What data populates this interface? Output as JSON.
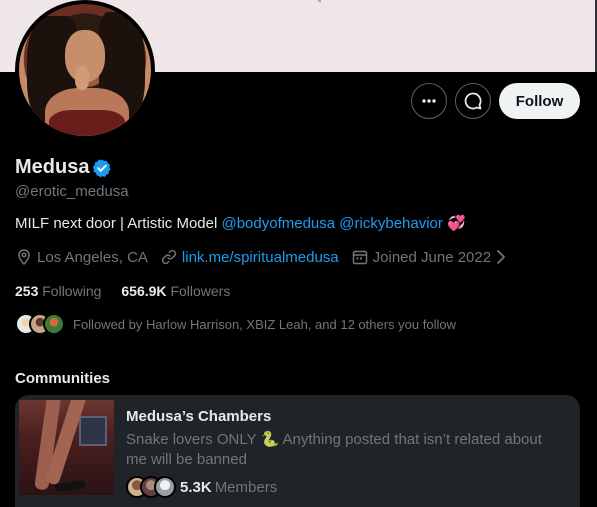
{
  "profile": {
    "name": "Medusa",
    "handle": "@erotic_medusa",
    "bio_text": "MILF next door | Artistic Model ",
    "bio_mention_1": "@bodyofmedusa",
    "bio_mention_2": "@rickybehavior",
    "bio_emoji": "💞",
    "location": "Los Angeles, CA",
    "link": "link.me/spiritualmedusa",
    "joined": "Joined June 2022",
    "following_count": "253",
    "following_label": "Following",
    "followers_count": "656.9K",
    "followers_label": "Followers",
    "followed_by": "Followed by Harlow Harrison, XBIZ Leah, and 12 others you follow"
  },
  "actions": {
    "follow_label": "Follow"
  },
  "communities": {
    "title": "Communities",
    "items": [
      {
        "name": "Medusa’s Chambers",
        "description_1": "Snake lovers ONLY ",
        "description_emoji": "🐍",
        "description_2": " Anything posted that isn’t related about me will be banned",
        "members_count": "5.3K",
        "members_label": "Members"
      }
    ]
  },
  "colors": {
    "accent": "#1d9bf0",
    "background": "#000000",
    "muted_text": "#71767b"
  },
  "icons": [
    "more-icon",
    "message-icon",
    "verified-badge-icon",
    "location-icon",
    "link-icon",
    "calendar-icon",
    "chevron-right-icon"
  ]
}
